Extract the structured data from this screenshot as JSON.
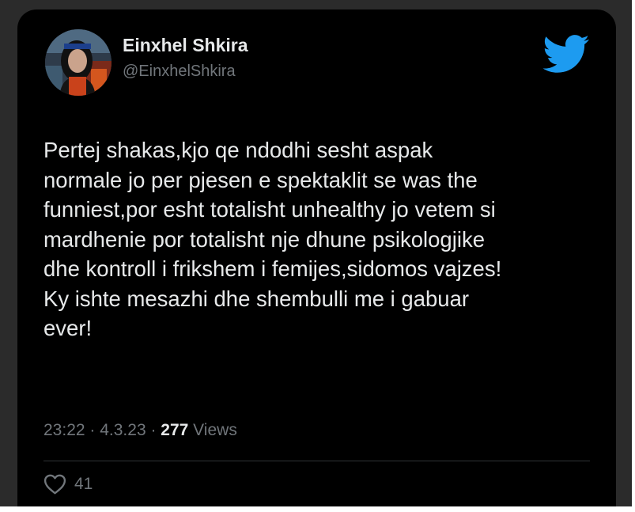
{
  "tweet": {
    "author": {
      "display_name": "Einxhel Shkira",
      "handle": "@EinxhelShkira",
      "avatar_icon": "profile-photo"
    },
    "platform_icon": "twitter-bird-icon",
    "text_lines": [
      "Pertej shakas,kjo qe ndodhi sesht aspak",
      "normale jo per pjesen e spektaklit se was the",
      "funniest,por esht totalisht unhealthy jo vetem si",
      "mardhenie por totalisht nje dhune psikologjike",
      "dhe kontroll i frikshem i femijes,sidomos vajzes!",
      "Ky ishte mesazhi dhe shembulli me i gabuar",
      "ever!"
    ],
    "time": "23:22",
    "separator": " · ",
    "date": "4.3.23",
    "views_count": "277",
    "views_label": " Views",
    "likes_count": "41",
    "like_icon": "heart-outline-icon"
  },
  "colors": {
    "background": "#000000",
    "frame": "#2b2b2b",
    "primary_text": "#e7e9ea",
    "secondary_text": "#71767b",
    "twitter_blue": "#1d9bf0",
    "divider": "#2f3336"
  }
}
